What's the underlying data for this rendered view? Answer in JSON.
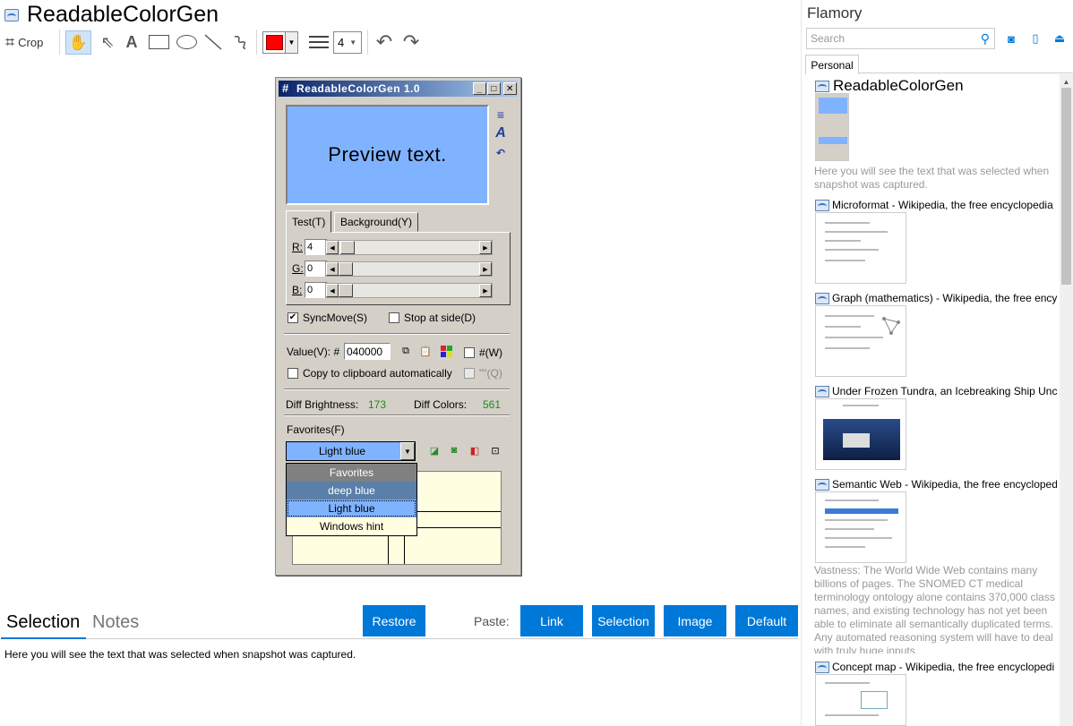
{
  "page": {
    "title": "ReadableColorGen"
  },
  "toolbar": {
    "crop_label": "Crop",
    "line_width": "4"
  },
  "rcg": {
    "title": "ReadableColorGen 1.0",
    "preview_text": "Preview text.",
    "tab_text": "Test(T)",
    "tab_background": "Background(Y)",
    "r_label": "R:",
    "r_value": "4",
    "g_label": "G:",
    "g_value": "0",
    "b_label": "B:",
    "b_value": "0",
    "syncmove": "SyncMove(S)",
    "stop_at_side": "Stop at side(D)",
    "value_label": "Value(V): #",
    "value": "040000",
    "hash_w": "#(W)",
    "copy_clipboard": "Copy to clipboard automatically",
    "quote_q": "\"\"(Q)",
    "diff_brightness_label": "Diff Brightness:",
    "diff_brightness": "173",
    "diff_colors_label": "Diff Colors:",
    "diff_colors": "561",
    "favorites_label": "Favorites(F)",
    "favorites_selected": "Light blue",
    "favorites_options": [
      "Favorites",
      "deep blue",
      "Light blue",
      "Windows hint"
    ]
  },
  "bottom": {
    "tab_selection": "Selection",
    "tab_notes": "Notes",
    "restore": "Restore",
    "paste_label": "Paste:",
    "paste_link": "Link",
    "paste_selection": "Selection",
    "paste_image": "Image",
    "paste_default": "Default",
    "selection_text": "Here you will see the text that was selected when snapshot was captured."
  },
  "sidebar": {
    "title": "Flamory",
    "search_placeholder": "Search",
    "tab_personal": "Personal",
    "snapshots": [
      {
        "title": "ReadableColorGen",
        "desc": "Here you will see the text that was selected when snapshot was captured."
      },
      {
        "title": "Microformat - Wikipedia, the free encyclopedia",
        "desc": ""
      },
      {
        "title": "Graph (mathematics) - Wikipedia, the free ency",
        "desc": ""
      },
      {
        "title": "Under Frozen Tundra, an Icebreaking Ship Unco",
        "desc": ""
      },
      {
        "title": "Semantic Web - Wikipedia, the free encycloped",
        "desc": "Vastness: The World Wide Web contains many billions of pages. The SNOMED CT medical terminology ontology alone contains 370,000 class names, and existing technology has not yet been able to eliminate all semantically duplicated terms. Any automated reasoning system will have to deal with truly huge inputs."
      },
      {
        "title": "Concept map - Wikipedia, the free encyclopedi",
        "desc": ""
      }
    ]
  },
  "colors": {
    "accent": "#0078d7",
    "preview_bg": "#80b3ff",
    "titlebar": "#0a246a",
    "pen": "#ff0000"
  }
}
